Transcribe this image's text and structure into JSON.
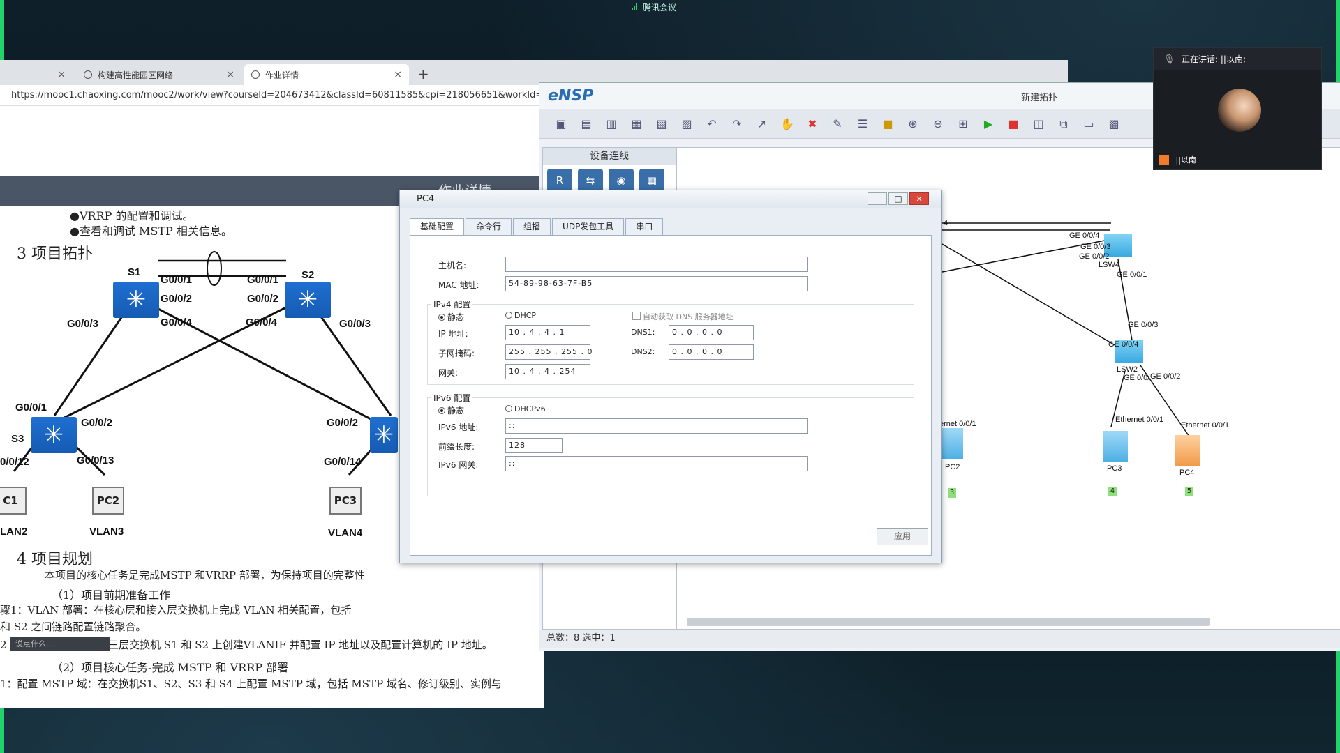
{
  "meeting": {
    "app_name": "腾讯会议"
  },
  "browser": {
    "tabs": [
      {
        "label": ""
      },
      {
        "label": "构建高性能园区网络"
      },
      {
        "label": "作业详情"
      }
    ],
    "new_tab": "+",
    "url": "https://mooc1.chaoxing.com/mooc2/work/view?courseId=204673412&classId=60811585&cpi=218056651&workId=2278",
    "page_header": "作业详情"
  },
  "doc": {
    "bullets": [
      "●VRRP 的配置和调试。",
      "●查看和调试 MSTP 相关信息。"
    ],
    "section3": "3 项目拓扑",
    "section4": "4 项目规划",
    "intro": "本项目的核心任务是完成MSTP 和VRRP 部署，为保持项目的完整性",
    "sub1": "（1）项目前期准备工作",
    "step1a": "骤1：VLAN 部署：在核心层和接入层交换机上完成 VLAN 相关配置，包括",
    "step1b": "和 S2 之间链路配置链路聚合。",
    "step2": "2 IP 地址部署：在核心三层交换机 S1 和 S2 上创建VLANIF 并配置 IP 地址以及配置计算机的 IP 地址。",
    "sub2": "（2）项目核心任务-完成 MSTP  和 VRRP  部署",
    "step3": "1：配置 MSTP 域：在交换机S1、S2、S3 和 S4 上配置 MSTP 域，包括 MSTP 域名、修订级别、实例与",
    "topo": {
      "S1": "S1",
      "S2": "S2",
      "S3": "S3",
      "s1_g1": "G0/0/1",
      "s1_g2": "G0/0/2",
      "s1_g3": "G0/0/3",
      "s1_g4": "G0/0/4",
      "s2_g1": "G0/0/1",
      "s2_g2": "G0/0/2",
      "s2_g3": "G0/0/3",
      "s2_g4": "G0/0/4",
      "s3_g1": "G0/0/1",
      "s3_g2": "G0/0/2",
      "s3_g12": "0/0/12",
      "s3_g13": "G0/0/13",
      "s4_g2": "G0/0/2",
      "s4_g14": "G0/0/14",
      "pc1": "C1",
      "pc2": "PC2",
      "pc3": "PC3",
      "vlan2": "LAN2",
      "vlan3": "VLAN3",
      "vlan4": "VLAN4"
    }
  },
  "ensp": {
    "logo": "eNSP",
    "project": "新建拓扑",
    "panel_title": "设备连线",
    "status": "总数：8  选中：1",
    "canvas": {
      "lsw4": "LSW4",
      "lsw2": "LSW2",
      "ge004": "GE 0/0/4",
      "ge003": "GE 0/0/3",
      "ge002": "GE 0/0/2",
      "ge001": "GE 0/0/1",
      "l2_ge003": "GE 0/0/3",
      "l2_ge004": "GE 0/0/4",
      "l2_ge00": "GE 0/0/",
      "l2_ge002": "GE 0/0/2",
      "eth_pc2": "ernet 0/0/1",
      "eth_pc3": "Ethernet 0/0/1",
      "eth_pc4": "Ethernet 0/0/1",
      "pc2": "PC2",
      "pc3": "PC3",
      "pc4": "PC4",
      "v3": "3",
      "v4": "4",
      "v5": "5",
      "edge4": "4"
    }
  },
  "dialog": {
    "title": "PC4",
    "tabs": [
      "基础配置",
      "命令行",
      "组播",
      "UDP发包工具",
      "串口"
    ],
    "hostname_label": "主机名:",
    "hostname_value": "",
    "mac_label": "MAC 地址:",
    "mac_value": "54-89-98-63-7F-B5",
    "ipv4_group": "IPv4 配置",
    "static": "静态",
    "dhcp": "DHCP",
    "auto_dns": "自动获取 DNS 服务器地址",
    "ip_label": "IP 地址:",
    "ip_value": "10  .  4  .  4  .  1",
    "mask_label": "子网掩码:",
    "mask_value": "255  .  255  .  255  .  0",
    "gw_label": "网关:",
    "gw_value": "10  .  4  .  4  .  254",
    "dns1_label": "DNS1:",
    "dns1_value": "0  .  0  .  0  .  0",
    "dns2_label": "DNS2:",
    "dns2_value": "0  .  0  .  0  .  0",
    "ipv6_group": "IPv6 配置",
    "static6": "静态",
    "dhcpv6": "DHCPv6",
    "ipv6_label": "IPv6 地址:",
    "ipv6_value": "::",
    "prefix_label": "前缀长度:",
    "prefix_value": "128",
    "gw6_label": "IPv6 网关:",
    "gw6_value": "::",
    "apply": "应用"
  },
  "video": {
    "speaking": "正在讲话: ||以南;",
    "name": "||以南"
  },
  "chat": {
    "placeholder": "说点什么..."
  }
}
